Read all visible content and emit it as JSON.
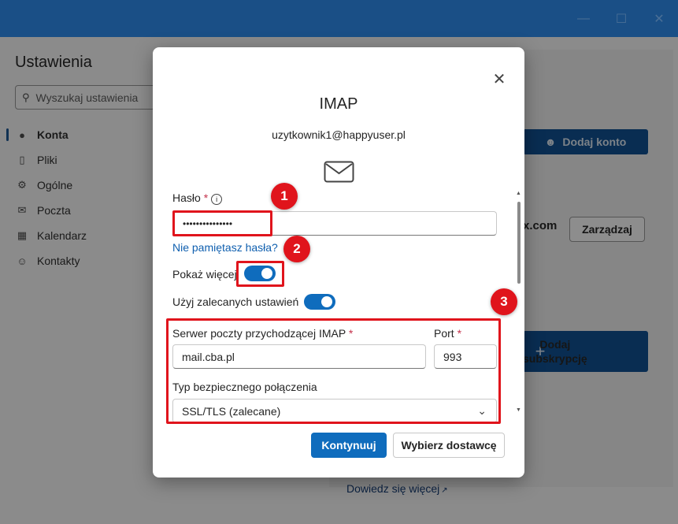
{
  "window": {
    "minimize": "—",
    "maximize": "☐",
    "close": "✕"
  },
  "background": {
    "title": "Ustawienia",
    "search_placeholder": "Wyszukaj ustawienia",
    "nav": [
      {
        "label": "Konta",
        "icon": "person-icon",
        "glyph": "●"
      },
      {
        "label": "Pliki",
        "icon": "file-icon",
        "glyph": "▯"
      },
      {
        "label": "Ogólne",
        "icon": "gear-icon",
        "glyph": "⚙"
      },
      {
        "label": "Poczta",
        "icon": "mail-icon",
        "glyph": "✉"
      },
      {
        "label": "Kalendarz",
        "icon": "calendar-icon",
        "glyph": "▦"
      },
      {
        "label": "Kontakty",
        "icon": "contacts-icon",
        "glyph": "☺"
      }
    ],
    "add_account_label": "Dodaj konto",
    "domain_fragment": "x.com",
    "manage_label": "Zarządzaj",
    "subscribe_line1": "Dodaj",
    "subscribe_line2": "subskrypcję",
    "learn_more": "Dowiedz się więcej"
  },
  "dialog": {
    "title": "IMAP",
    "email": "uzytkownik1@happyuser.pl",
    "password_label": "Hasło",
    "required_mark": "*",
    "password_value": "•••••••••••••••",
    "forgot_link": "Nie pamiętasz hasła?",
    "show_more_label": "Pokaż więcej",
    "recommended_label": "Użyj zalecanych ustawień",
    "server_label": "Serwer poczty przychodzącej IMAP",
    "server_value": "mail.cba.pl",
    "port_label": "Port",
    "port_value": "993",
    "security_label": "Typ bezpiecznego połączenia",
    "security_value": "SSL/TLS (zalecane)",
    "continue_label": "Kontynuuj",
    "choose_provider_label": "Wybierz dostawcę"
  },
  "annotations": [
    "1",
    "2",
    "3"
  ],
  "colors": {
    "titlebar": "#1a4f86",
    "accent": "#0f6cbd",
    "annotation": "#e0141c"
  }
}
